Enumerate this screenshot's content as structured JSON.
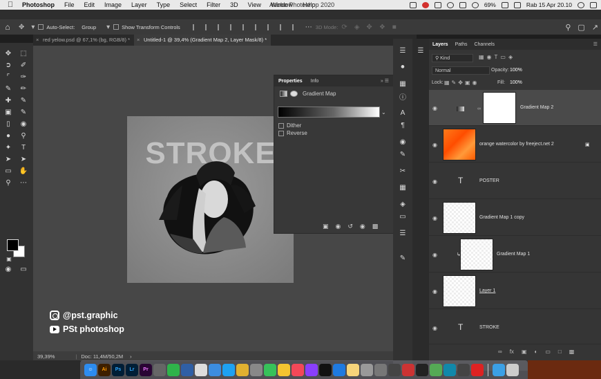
{
  "menubar": {
    "app": "Photoshop",
    "items": [
      "File",
      "Edit",
      "Image",
      "Layer",
      "Type",
      "Select",
      "Filter",
      "3D",
      "View",
      "Window",
      "Help"
    ],
    "window_title": "Adobe Photoshop 2020",
    "battery": "69%",
    "clock": "Rab 15 Apr  20.10"
  },
  "options": {
    "auto_select": "Auto-Select:",
    "group": "Group",
    "show_transform": "Show Transform Controls",
    "mode_3d": "3D Mode:"
  },
  "tabs": [
    {
      "label": "red yelow.psd @ 67,1% (bg, RGB/8) *"
    },
    {
      "label": "Untitled-1 @ 39,4% (Gradient Map 2, Layer Mask/8) *"
    }
  ],
  "status": {
    "zoom": "39,39%",
    "doc": "Doc: 11,4M/50,2M"
  },
  "artboard": {
    "title": "STROKE"
  },
  "properties": {
    "tabs": [
      "Properties",
      "Info"
    ],
    "adjustment": "Gradient Map",
    "dither": "Dither",
    "reverse": "Reverse",
    "gradient_colors": [
      "#000000",
      "#ffffff"
    ]
  },
  "layers_panel": {
    "tabs": [
      "Layers",
      "Paths",
      "Channels"
    ],
    "filter": "Kind",
    "blend": "Normal",
    "opacity_label": "Opacity:",
    "opacity": "100%",
    "lock_label": "Lock:",
    "fill_label": "Fill:",
    "fill": "100%",
    "layers": [
      {
        "name": "Gradient Map 2",
        "selected": true
      },
      {
        "name": "orange watercolor by freeject.net 2",
        "selected": false
      },
      {
        "name": "POSTER",
        "selected": false
      },
      {
        "name": "Gradient Map 1 copy",
        "selected": false
      },
      {
        "name": "Gradient Map 1",
        "selected": false
      },
      {
        "name": "Layer 1",
        "selected": false
      },
      {
        "name": "STROKE",
        "selected": false
      }
    ]
  },
  "watermark": {
    "instagram": "@pst.graphic",
    "youtube": "PSt photoshop"
  },
  "dock": [
    "Ai",
    "Ps",
    "Lr",
    "Pr"
  ],
  "colors": {
    "accent": "#2d8cf0",
    "panel": "#353535"
  }
}
